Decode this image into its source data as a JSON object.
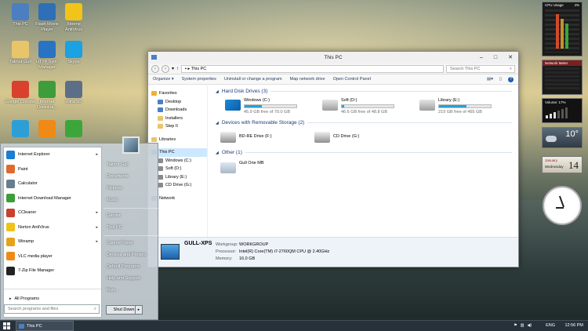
{
  "desktop_icons": [
    {
      "label": "This PC",
      "color": "#4b7fc1"
    },
    {
      "label": "Flash Movie Player",
      "color": "#2f6fb8"
    },
    {
      "label": "Xtreme AntiVirus",
      "color": "#f2c318"
    },
    {
      "label": "Taimur Gull",
      "color": "#e9c56a"
    },
    {
      "label": "HTTP Sync Manager",
      "color": "#2873c4"
    },
    {
      "label": "Skype",
      "color": "#1aa2e2"
    },
    {
      "label": "Google Chrome",
      "color": "#d9412e"
    },
    {
      "label": "Internet Downloa...",
      "color": "#3d9d3a"
    },
    {
      "label": "UltraISO",
      "color": "#5d6f88"
    },
    {
      "label": "",
      "color": "#2e9fd6"
    },
    {
      "label": "",
      "color": "#f08a16"
    },
    {
      "label": "",
      "color": "#3da63a"
    }
  ],
  "explorer": {
    "title": "This PC",
    "path": "This PC",
    "search_placeholder": "Search This PC",
    "commands": [
      "Organize ▾",
      "System properties",
      "Uninstall or change a program",
      "Map network drive",
      "Open Control Panel"
    ],
    "nav": [
      {
        "label": "Favorites",
        "color": "#e9b52e"
      },
      {
        "label": "Desktop",
        "color": "#4b7fc1"
      },
      {
        "label": "Downloads",
        "color": "#4b7fc1"
      },
      {
        "label": "Installers",
        "color": "#e9c56a"
      },
      {
        "label": "Step II",
        "color": "#e9c56a"
      },
      {
        "label": "",
        "color": ""
      },
      {
        "label": "Libraries",
        "color": "#e9c56a"
      },
      {
        "label": "",
        "color": ""
      },
      {
        "label": "This PC",
        "color": "#4b7fc1"
      },
      {
        "label": "Windows (C:)",
        "color": "#8a8a8a"
      },
      {
        "label": "Soft (D:)",
        "color": "#8a8a8a"
      },
      {
        "label": "Library (E:)",
        "color": "#8a8a8a"
      },
      {
        "label": "CD Drive (G:)",
        "color": "#8a8a8a"
      },
      {
        "label": "",
        "color": ""
      },
      {
        "label": "Network",
        "color": "#4b7fc1"
      }
    ],
    "groups": {
      "hdd": "Hard Disk Drives (3)",
      "removable": "Devices with Removable Storage (2)",
      "other": "Other (1)"
    },
    "drives": [
      {
        "name": "Windows (C:)",
        "free": "45.9 GB free of 70.0 GB",
        "used_fraction": 0.34
      },
      {
        "name": "Soft (D:)",
        "free": "46.6 GB free of 48.8 GB",
        "used_fraction": 0.05
      },
      {
        "name": "Library (E:)",
        "free": "219 GB free of 465 GB",
        "used_fraction": 0.53
      }
    ],
    "removable": [
      {
        "name": "BD-RE Drive (F:)"
      },
      {
        "name": "CD Drive (G:)"
      }
    ],
    "other": [
      {
        "name": "Gull One MB"
      }
    ],
    "details": {
      "pc_name": "GULL-XPS",
      "workgroup_label": "Workgroup:",
      "workgroup": "WORKGROUP",
      "processor_label": "Processor:",
      "processor": "Intel(R) Core(TM) i7-2760QM CPU @ 2.40GHz",
      "memory_label": "Memory:",
      "memory": "16.0 GB"
    }
  },
  "start_menu": {
    "programs": [
      {
        "label": "Internet Explorer",
        "arrow": true,
        "color": "#1c7dd4"
      },
      {
        "label": "Paint",
        "arrow": false,
        "color": "#e06a2e"
      },
      {
        "label": "Calculator",
        "arrow": false,
        "color": "#6a7d8f"
      },
      {
        "label": "Internet Download Manager",
        "arrow": false,
        "color": "#3d9d3a"
      },
      {
        "label": "CCleaner",
        "arrow": true,
        "color": "#c8402e"
      },
      {
        "label": "Norton AntiVirus",
        "arrow": true,
        "color": "#f0c21a"
      },
      {
        "label": "Winamp",
        "arrow": true,
        "color": "#e7a21c"
      },
      {
        "label": "VLC media player",
        "arrow": false,
        "color": "#f08a16"
      },
      {
        "label": "7-Zip File Manager",
        "arrow": false,
        "color": "#222222"
      }
    ],
    "all_programs": "All Programs",
    "search_placeholder": "Search programs and files",
    "right": [
      "Taimur Gull",
      "Documents",
      "Pictures",
      "Music",
      "Games",
      "This PC",
      "Control Panel",
      "Devices and Printers",
      "Default Programs",
      "Help and Support",
      "Run..."
    ],
    "shutdown": "Shut Down"
  },
  "taskbar": {
    "window": "This PC",
    "lang": "ENG",
    "time": "12:56 PM"
  },
  "gadgets": {
    "cpu_title": "CPU Usage",
    "cpu_value": "4%",
    "net_title": "Network Meter",
    "volume": "Volume: 17%",
    "temp": "10°",
    "month": "January",
    "weekday": "Wednesday",
    "day": "14"
  }
}
